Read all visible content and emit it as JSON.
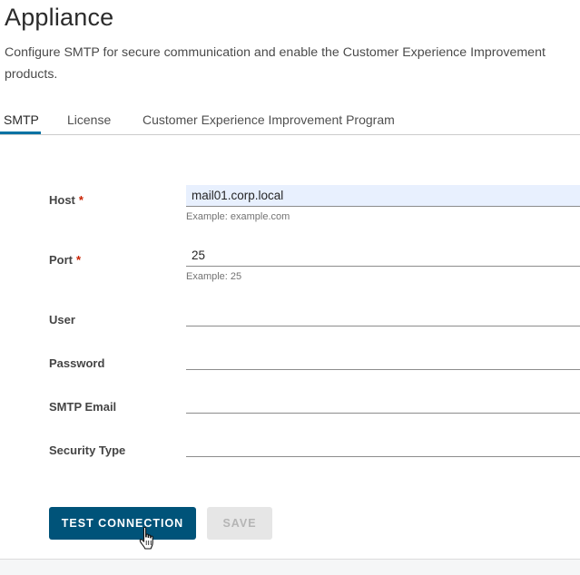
{
  "page": {
    "title": "Appliance",
    "description_line1": "Configure SMTP for secure communication and enable the Customer Experience Improvement",
    "description_line2": "products."
  },
  "tabs": [
    {
      "label": "SMTP",
      "active": true
    },
    {
      "label": "License",
      "active": false
    },
    {
      "label": "Customer Experience Improvement Program",
      "active": false
    }
  ],
  "form": {
    "host": {
      "label": "Host",
      "required_mark": "*",
      "value": "mail01.corp.local",
      "helper": "Example: example.com"
    },
    "port": {
      "label": "Port",
      "required_mark": "*",
      "value": "25",
      "helper": "Example: 25"
    },
    "user": {
      "label": "User",
      "value": ""
    },
    "password": {
      "label": "Password",
      "value": ""
    },
    "smtp_email": {
      "label": "SMTP Email",
      "value": ""
    },
    "security_type": {
      "label": "Security Type",
      "value": ""
    }
  },
  "buttons": {
    "test_connection": "TEST CONNECTION",
    "save": "SAVE"
  },
  "colors": {
    "accent": "#0072a3",
    "primary_button": "#005379",
    "required": "#c92100",
    "autofill_bg": "#e8f0fe"
  }
}
